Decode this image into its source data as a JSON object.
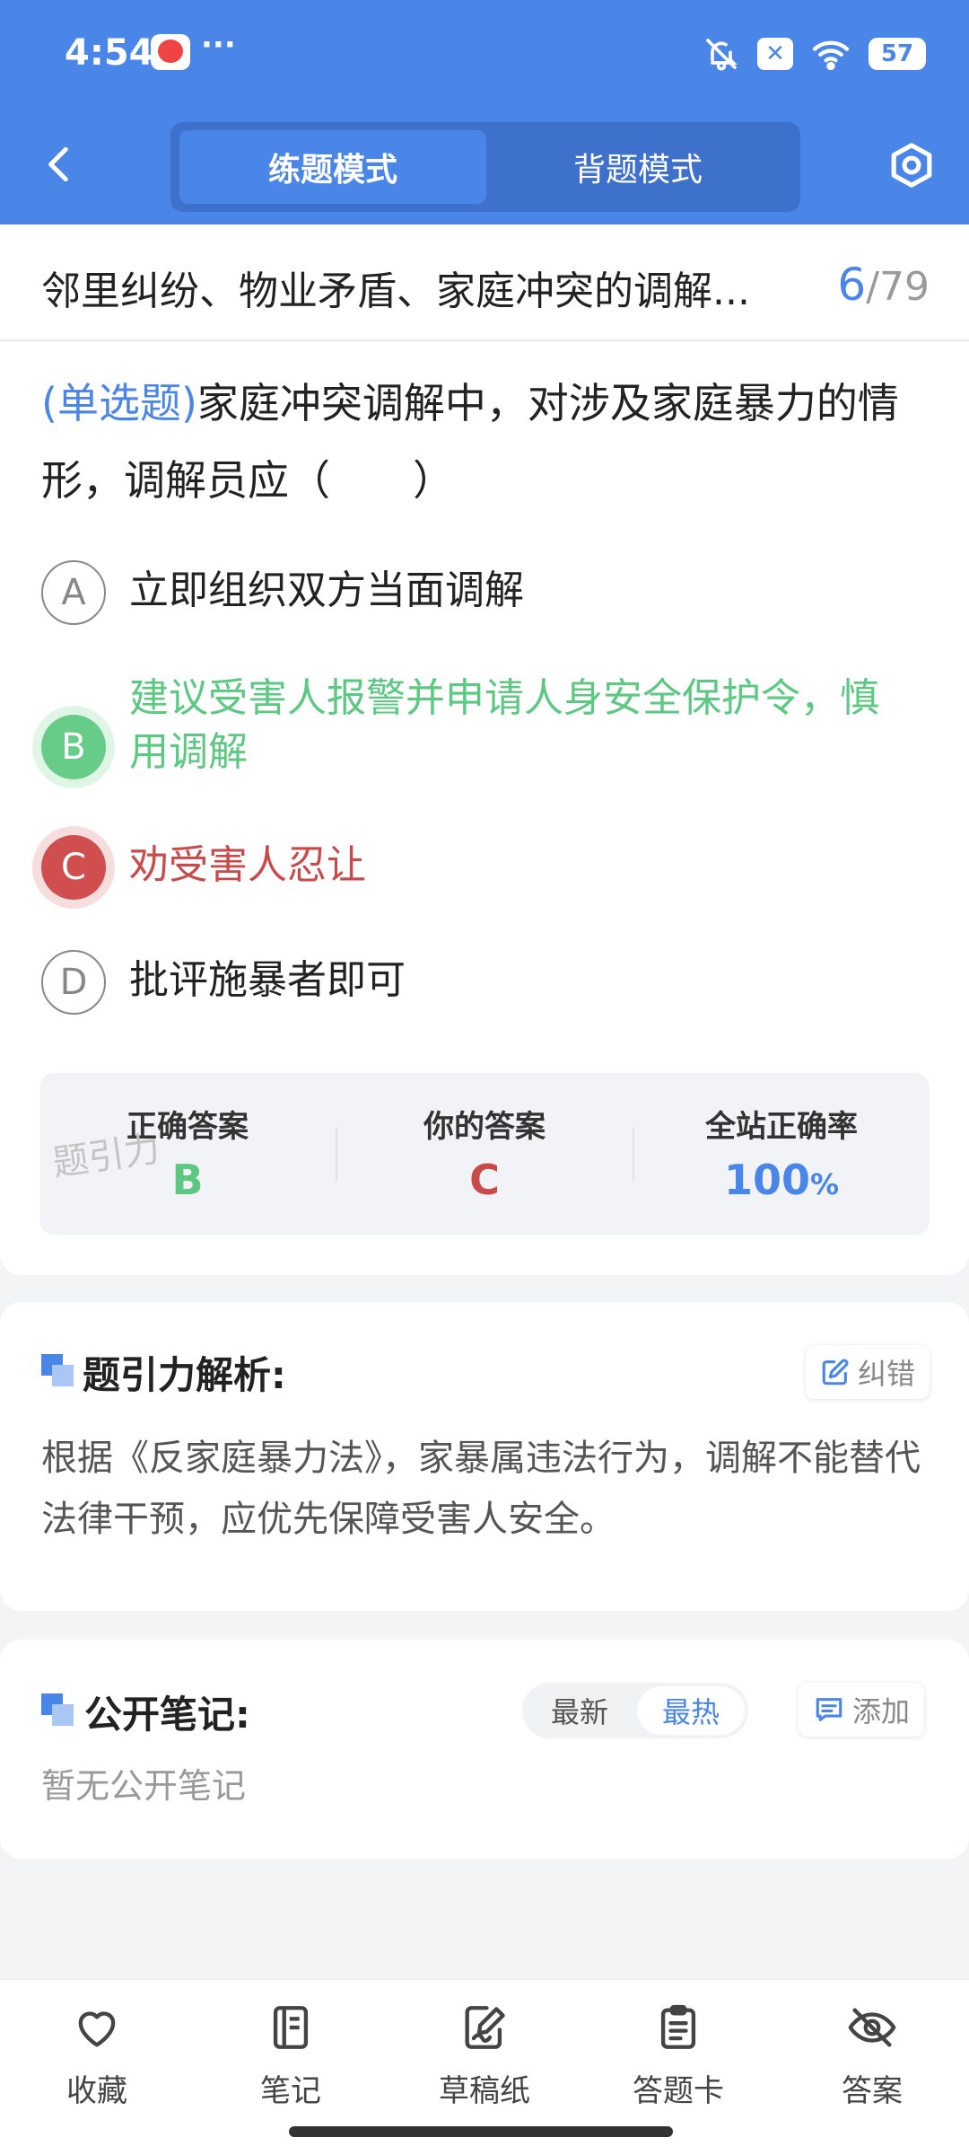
{
  "status_bar": {
    "time": "4:54",
    "more": "···",
    "battery": "57"
  },
  "nav": {
    "tabs": [
      {
        "label": "练题模式"
      },
      {
        "label": "背题模式"
      }
    ]
  },
  "title_row": {
    "title": "邻里纠纷、物业矛盾、家庭冲突的调解...",
    "current": "6",
    "total": "/79"
  },
  "question": {
    "type_label": "(单选题)",
    "stem": "家庭冲突调解中，对涉及家庭暴力的情形，调解员应（　　）",
    "options": [
      {
        "letter": "A",
        "text": "立即组织双方当面调解",
        "state": "normal"
      },
      {
        "letter": "B",
        "text": "建议受害人报警并申请人身安全保护令，慎用调解",
        "state": "correct"
      },
      {
        "letter": "C",
        "text": "劝受害人忍让",
        "state": "wrong"
      },
      {
        "letter": "D",
        "text": "批评施暴者即可",
        "state": "normal"
      }
    ]
  },
  "stats": {
    "correct_label": "正确答案",
    "correct_value": "B",
    "yours_label": "你的答案",
    "yours_value": "C",
    "rate_label": "全站正确率",
    "rate_value": "100",
    "rate_unit": "%"
  },
  "watermark": "题引力",
  "analysis": {
    "title": "题引力解析:",
    "correct_btn": "纠错",
    "text": "根据《反家庭暴力法》，家暴属违法行为，调解不能替代法律干预，应优先保障受害人安全。"
  },
  "notes": {
    "title": "公开笔记:",
    "sort": {
      "latest": "最新",
      "hottest": "最热"
    },
    "add_btn": "添加",
    "empty_text": "暂无公开笔记"
  },
  "bottom_bar": {
    "items": [
      {
        "label": "收藏",
        "icon": "heart-icon"
      },
      {
        "label": "笔记",
        "icon": "notebook-icon"
      },
      {
        "label": "草稿纸",
        "icon": "draft-icon"
      },
      {
        "label": "答题卡",
        "icon": "answer-sheet-icon"
      },
      {
        "label": "答案",
        "icon": "eye-off-icon"
      }
    ]
  },
  "colors": {
    "primary": "#4a86e8",
    "correct": "#5cc882",
    "wrong": "#c94a4a"
  }
}
